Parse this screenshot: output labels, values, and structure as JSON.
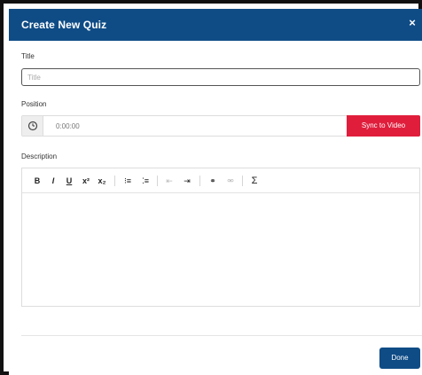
{
  "dialog": {
    "title": "Create New Quiz",
    "close_symbol": "×"
  },
  "title_field": {
    "label": "Title",
    "placeholder": "Title",
    "value": ""
  },
  "position_field": {
    "label": "Position",
    "icon": "clock-icon",
    "value": "0:00:00",
    "sync_button_label": "Sync to Video"
  },
  "description_field": {
    "label": "Description",
    "toolbar": {
      "bold": "B",
      "italic": "I",
      "underline": "U",
      "superscript": "x²",
      "subscript": "x₂",
      "ordered_list": "⁝≡",
      "unordered_list": "⁚≡",
      "outdent": "⇤",
      "indent": "⇥",
      "link": "⚭",
      "unlink": "⚮",
      "formula": "Σ"
    },
    "value": ""
  },
  "footer": {
    "done_label": "Done"
  },
  "colors": {
    "header_bg": "#0f4c86",
    "sync_button_bg": "#e01e3c",
    "done_button_bg": "#0f4c86"
  }
}
